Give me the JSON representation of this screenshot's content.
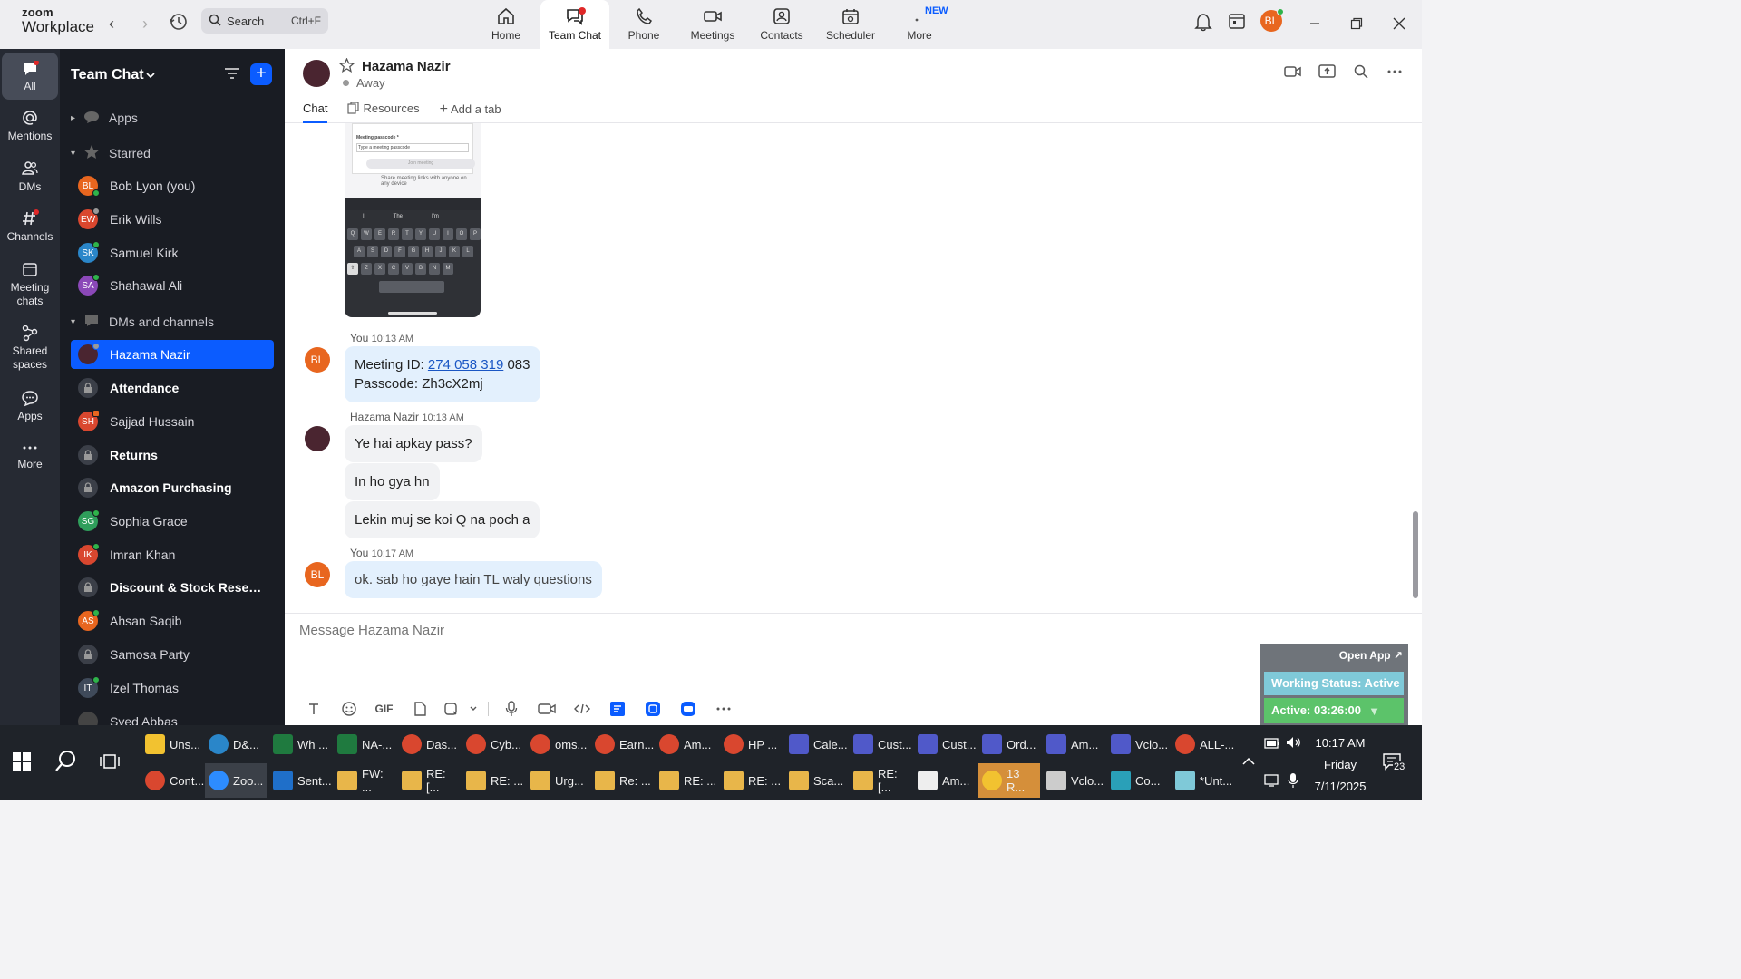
{
  "app": {
    "brand_top": "zoom",
    "brand_bottom": "Workplace"
  },
  "search": {
    "label": "Search",
    "shortcut": "Ctrl+F"
  },
  "top_nav": [
    {
      "label": "Home",
      "icon": "home-icon"
    },
    {
      "label": "Team Chat",
      "icon": "chat-icon",
      "active": true
    },
    {
      "label": "Phone",
      "icon": "phone-icon"
    },
    {
      "label": "Meetings",
      "icon": "video-icon"
    },
    {
      "label": "Contacts",
      "icon": "contacts-icon"
    },
    {
      "label": "Scheduler",
      "icon": "calendar-icon"
    },
    {
      "label": "More",
      "icon": "more-icon",
      "badge": "NEW"
    }
  ],
  "user": {
    "initials": "BL",
    "color": "#e8661f"
  },
  "rail": [
    {
      "label": "All"
    },
    {
      "label": "Mentions"
    },
    {
      "label": "DMs"
    },
    {
      "label": "Channels"
    },
    {
      "label": "Meeting chats"
    },
    {
      "label": "Shared spaces"
    },
    {
      "label": "Apps"
    },
    {
      "label": "More"
    }
  ],
  "sidebar": {
    "title": "Team Chat",
    "sections": {
      "apps": "Apps",
      "starred": "Starred",
      "dms": "DMs and channels"
    },
    "starred": [
      {
        "initials": "BL",
        "name": "Bob Lyon (you)",
        "color": "#e8661f"
      },
      {
        "initials": "EW",
        "name": "Erik Wills",
        "color": "#d9472f"
      },
      {
        "initials": "SK",
        "name": "Samuel Kirk",
        "color": "#2a86c9"
      },
      {
        "initials": "SA",
        "name": "Shahawal Ali",
        "color": "#8b48b8"
      }
    ],
    "items": [
      {
        "type": "avatar",
        "initials": "",
        "name": "Hazama Nazir",
        "color": "#4a2530",
        "selected": true
      },
      {
        "type": "lock",
        "name": "Attendance",
        "bold": true
      },
      {
        "type": "avatar",
        "initials": "SH",
        "name": "Sajjad Hussain",
        "color": "#d9472f"
      },
      {
        "type": "lock",
        "name": "Returns",
        "bold": true
      },
      {
        "type": "lock",
        "name": "Amazon Purchasing",
        "bold": true
      },
      {
        "type": "avatar",
        "initials": "SG",
        "name": "Sophia Grace",
        "color": "#2f9e5b"
      },
      {
        "type": "avatar",
        "initials": "IK",
        "name": "Imran Khan",
        "color": "#d9472f"
      },
      {
        "type": "lock",
        "name": "Discount & Stock Reserva...",
        "bold": true
      },
      {
        "type": "avatar",
        "initials": "AS",
        "name": "Ahsan Saqib",
        "color": "#e8661f"
      },
      {
        "type": "lock",
        "name": "Samosa Party",
        "bold": false
      },
      {
        "type": "avatar",
        "initials": "IT",
        "name": "Izel Thomas",
        "color": "#3f4a5a"
      },
      {
        "type": "avatar",
        "initials": "",
        "name": "Syed Abbas",
        "color": "#444"
      }
    ]
  },
  "chat": {
    "contact_name": "Hazama Nazir",
    "status": "Away",
    "tabs": {
      "chat": "Chat",
      "resources": "Resources",
      "add": "Add a tab"
    },
    "screenshot_text": {
      "passcode_label": "Meeting passcode *",
      "passcode_placeholder": "Type a meeting passcode",
      "join": "Join meeting",
      "share": "Share meeting links with anyone on any device",
      "suggest": [
        "I",
        "The",
        "I'm"
      ],
      "row1": [
        "Q",
        "W",
        "E",
        "R",
        "T",
        "Y",
        "U",
        "I",
        "O",
        "P"
      ],
      "row2": [
        "A",
        "S",
        "D",
        "F",
        "G",
        "H",
        "J",
        "K",
        "L"
      ],
      "row3": [
        "Z",
        "X",
        "C",
        "V",
        "B",
        "N",
        "M"
      ]
    },
    "messages": [
      {
        "sender": "You",
        "time": "10:13 AM"
      },
      {
        "link": "274 058 319",
        "after_link": "083",
        "line1_prefix": "Meeting ID:",
        "line2": "Passcode: Zh3cX2mj"
      },
      {
        "sender": "Hazama Nazir",
        "time": "10:13 AM"
      },
      {
        "text": "Ye hai apkay pass?"
      },
      {
        "text": "In ho gya hn"
      },
      {
        "text": "Lekin muj se koi Q na poch a"
      },
      {
        "sender": "You",
        "time": "10:17 AM"
      },
      {
        "text": "ok. sab ho gaye hain TL waly questions"
      }
    ],
    "composer_placeholder": "Message Hazama Nazir",
    "gif_label": "GIF"
  },
  "widget": {
    "open_app": "Open App ↗",
    "working_status": "Working Status: Active",
    "active_time": "Active: 03:26:00"
  },
  "taskbar": {
    "row1": [
      {
        "label": "Uns...",
        "color": "#f2c230",
        "sq": true
      },
      {
        "label": "D&...",
        "color": "#2a86c9"
      },
      {
        "label": "Wh ...",
        "color": "#1f7a3f",
        "sq": true
      },
      {
        "label": "NA-...",
        "color": "#1f7a3f",
        "sq": true
      },
      {
        "label": "Das...",
        "color": "#d9472f"
      },
      {
        "label": "Cyb...",
        "color": "#d9472f"
      },
      {
        "label": "oms...",
        "color": "#d9472f"
      },
      {
        "label": "Earn...",
        "color": "#d9472f"
      },
      {
        "label": "Am...",
        "color": "#d9472f"
      },
      {
        "label": "HP ...",
        "color": "#d9472f"
      },
      {
        "label": "Cale...",
        "color": "#5059c9",
        "sq": true
      },
      {
        "label": "Cust...",
        "color": "#5059c9",
        "sq": true
      },
      {
        "label": "Cust...",
        "color": "#5059c9",
        "sq": true
      },
      {
        "label": "Ord...",
        "color": "#5059c9",
        "sq": true
      },
      {
        "label": "Am...",
        "color": "#5059c9",
        "sq": true
      },
      {
        "label": "Vclo...",
        "color": "#5059c9",
        "sq": true
      },
      {
        "label": "ALL-...",
        "color": "#d9472f"
      }
    ],
    "row2": [
      {
        "label": "Cont...",
        "color": "#d9472f"
      },
      {
        "label": "Zoo...",
        "color": "#2d8cff",
        "active": true
      },
      {
        "label": "Sent...",
        "color": "#1f6fc9",
        "sq": true
      },
      {
        "label": "FW: ...",
        "color": "#e8b64a",
        "sq": true
      },
      {
        "label": "RE: [...",
        "color": "#e8b64a",
        "sq": true
      },
      {
        "label": "RE: ...",
        "color": "#e8b64a",
        "sq": true
      },
      {
        "label": "Urg...",
        "color": "#e8b64a",
        "sq": true
      },
      {
        "label": "Re: ...",
        "color": "#e8b64a",
        "sq": true
      },
      {
        "label": "RE: ...",
        "color": "#e8b64a",
        "sq": true
      },
      {
        "label": "RE: ...",
        "color": "#e8b64a",
        "sq": true
      },
      {
        "label": "Sca...",
        "color": "#e8b64a",
        "sq": true
      },
      {
        "label": "RE: [...",
        "color": "#e8b64a",
        "sq": true
      },
      {
        "label": "Am...",
        "color": "#eeeeee",
        "sq": true
      },
      {
        "label": "13 R...",
        "color": "#f2c230",
        "warn": true
      },
      {
        "label": "Vclo...",
        "color": "#cccccc",
        "sq": true
      },
      {
        "label": "Co...",
        "color": "#2aa0b8",
        "sq": true
      },
      {
        "label": "*Unt...",
        "color": "#7fc9d8",
        "sq": true
      }
    ],
    "time": "10:17 AM",
    "day": "Friday",
    "date": "7/11/2025",
    "notif_count": "23"
  }
}
